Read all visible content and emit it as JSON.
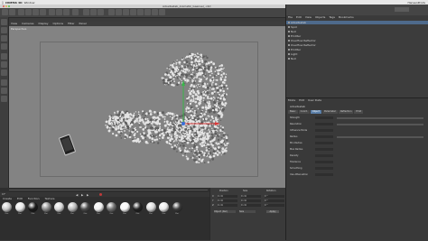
{
  "menubar": {
    "apple": "",
    "app": "CINEMA 4D",
    "items": [
      "Window"
    ],
    "right": "HansenProds"
  },
  "window": {
    "title": "Arbeitsstab_Animatik_Gaensel_.c4d"
  },
  "viewport": {
    "menu": [
      "View",
      "Cameras",
      "Display",
      "Options",
      "Filter",
      "Panel"
    ],
    "label": "Perspective"
  },
  "objects": {
    "menu": [
      "File",
      "Edit",
      "View",
      "Objects",
      "Tags",
      "Bookmarks"
    ],
    "rows": [
      {
        "name": "Arbeitsstab"
      },
      {
        "name": "Spot"
      },
      {
        "name": "Null"
      },
      {
        "name": "Emitter"
      },
      {
        "name": "Overflow Reflector"
      },
      {
        "name": "Overflow Reflector"
      },
      {
        "name": "Emitter"
      },
      {
        "name": "Light"
      },
      {
        "name": "Null"
      }
    ]
  },
  "attributes": {
    "menu": [
      "Mode",
      "Edit",
      "User Data"
    ],
    "header": "Arbeitsstab",
    "tabs": [
      "Basic",
      "Coord.",
      "Object",
      "Parameter",
      "Reflection",
      "Emit"
    ],
    "active_tab": "Object",
    "props": [
      {
        "label": "Strength",
        "value": ""
      },
      {
        "label": "Resolution",
        "value": ""
      },
      {
        "label": "Influence Mode",
        "value": ""
      },
      {
        "label": "Radius",
        "value": ""
      },
      {
        "label": "Min Radius",
        "value": ""
      },
      {
        "label": "Max Radius",
        "value": ""
      },
      {
        "label": "Density",
        "value": ""
      },
      {
        "label": "Tolerance",
        "value": ""
      },
      {
        "label": "Smoothing",
        "value": ""
      },
      {
        "label": "Use Attenuation",
        "value": ""
      }
    ]
  },
  "timeline": {
    "frame": "0 F"
  },
  "materials": {
    "menu": [
      "Create",
      "Edit",
      "Function",
      "Texture"
    ],
    "items": [
      {
        "name": "Mat",
        "color": "#c9c9c9"
      },
      {
        "name": "Mat",
        "color": "#e6e6e6"
      },
      {
        "name": "Mat",
        "color": "#1a1a1a"
      },
      {
        "name": "Mat",
        "color": "#888888"
      },
      {
        "name": "Mat",
        "color": "#d8d8d8"
      },
      {
        "name": "Mat",
        "color": "#b8b8b8"
      },
      {
        "name": "Mat",
        "color": "#4a4a4a"
      },
      {
        "name": "Mat",
        "color": "#f0f0f0"
      },
      {
        "name": "Mat",
        "color": "#707070"
      },
      {
        "name": "Mat",
        "color": "#f7f7f7"
      },
      {
        "name": "Mat",
        "color": "#222222"
      },
      {
        "name": "Mat",
        "color": "#dadada"
      },
      {
        "name": "Mat",
        "color": "#e8e8e8"
      },
      {
        "name": "Mat",
        "color": "#3a3a3a"
      }
    ]
  },
  "coords": {
    "headers": [
      "Position",
      "Size",
      "Rotation"
    ],
    "rows": [
      {
        "axis": "X",
        "pos": "0 cm",
        "size": "0 cm",
        "rot": "0 °"
      },
      {
        "axis": "Y",
        "pos": "0 cm",
        "size": "0 cm",
        "rot": "0 °"
      },
      {
        "axis": "Z",
        "pos": "0 cm",
        "size": "0 cm",
        "rot": "0 °"
      }
    ],
    "mode": "Object (Rel)",
    "size_mode": "Size",
    "apply": "Apply"
  },
  "colors": {
    "accent": "#5b7fa8",
    "viewport": "#838383",
    "axis_y": "#39b54a",
    "axis_x": "#d83a3a",
    "axis_z": "#3a6fd8"
  }
}
